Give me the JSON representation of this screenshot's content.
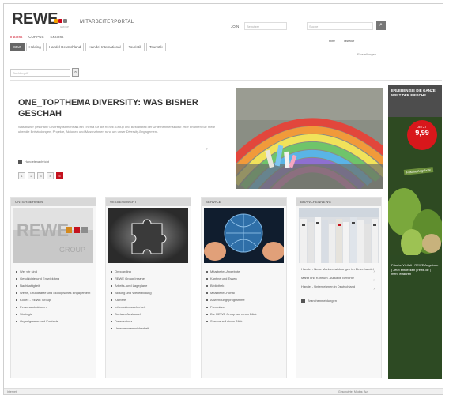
{
  "header": {
    "logo_text": "REWE",
    "logo_sub": "GROUP",
    "logo_dot_colors": [
      "#f4a000",
      "#cc071e",
      "#7f7f7f"
    ],
    "portal_title": "MITARBEITERPORTAL",
    "ext_tabs": [
      "Intranet",
      "CORPUS",
      "Extranet"
    ],
    "sub_tabs": [
      "Start",
      "Holding",
      "Handel Deutschland",
      "Handel International",
      "Touristik",
      "Touristik"
    ],
    "join_label": "JOIN",
    "join_placeholder": "Benutzer",
    "search_placeholder": "Suche",
    "search_button": "⌕",
    "util_links": [
      "Hilfe",
      "Tastatur"
    ],
    "util_sub": "Einstellungen"
  },
  "page_search": {
    "placeholder": "Suchbegriff",
    "button": "⌕"
  },
  "hero": {
    "title": "ONE_TOPTHEMA DIVERSITY: WAS BISHER GESCHAH",
    "text": "Was bisher geschah? Diversity ist mehr als ein Thema fur die REWE Group und Bestandteil der Unternehmenskultur. Hier erfahren Sie mehr uber die Entwicklungen, Projekte, Aktionen und Massnahmen rund um unser Diversity-Engagement.",
    "link": "Handelsnachricht",
    "pager": [
      "1",
      "2",
      "3",
      "4",
      "5"
    ],
    "active_page": "5",
    "arrow": "›"
  },
  "ad": {
    "title": "ERLEBEN SIE DIE GANZE WELT DER FRISCHE",
    "badge_top": "JETZT",
    "badge_price": "9,99",
    "tag": "Frische Angebote",
    "footer": "Frische Vielfalt | REWE Angebote | Jetzt entdecken | rewe.de | mehr erfahren"
  },
  "cards": {
    "unternehmen": {
      "title": "UNTERNEHMEN",
      "items": [
        "Wer wir sind",
        "Geschichte und Entwicklung",
        "Nachhaltigkeit",
        "Werte, Grundsatze und okologisches Engagement",
        "Kodex - REWE Group",
        "Personalstrukturen",
        "Strategie",
        "Organigramm und Kontakte"
      ]
    },
    "wissenswert": {
      "title": "WISSENSWERT",
      "items": [
        "Onboarding",
        "REWE Group Intranet",
        "Arbeits- und Lageplane",
        "Bildung und Weiterbildung",
        "Karriere",
        "Informationssicherheit",
        "Sozialer Austausch",
        "Datenschutz",
        "Unternehmenssicherheit"
      ]
    },
    "service": {
      "title": "SERVICE",
      "items": [
        "Mitarbeiter-Angebote",
        "Kantine und Essen",
        "Bibliothek",
        "Mitarbeiter-Portal",
        "Anwendungsprogramme",
        "Formulare",
        "Die REWE Group auf einen Blick",
        "Service auf einen Blick"
      ]
    },
    "news": {
      "title": "BRANCHENNEWS",
      "items": [
        "Handel - Neue Marktentwicklungen im Einzelhandel",
        "Markt und Konsum - Aktuelle Berichte",
        "Handel - Unternehmen in Deutschland"
      ],
      "link": "Branchenmeldungen"
    }
  },
  "status": {
    "left": "Internet",
    "right": "Geschutzter Modus: Aus"
  }
}
